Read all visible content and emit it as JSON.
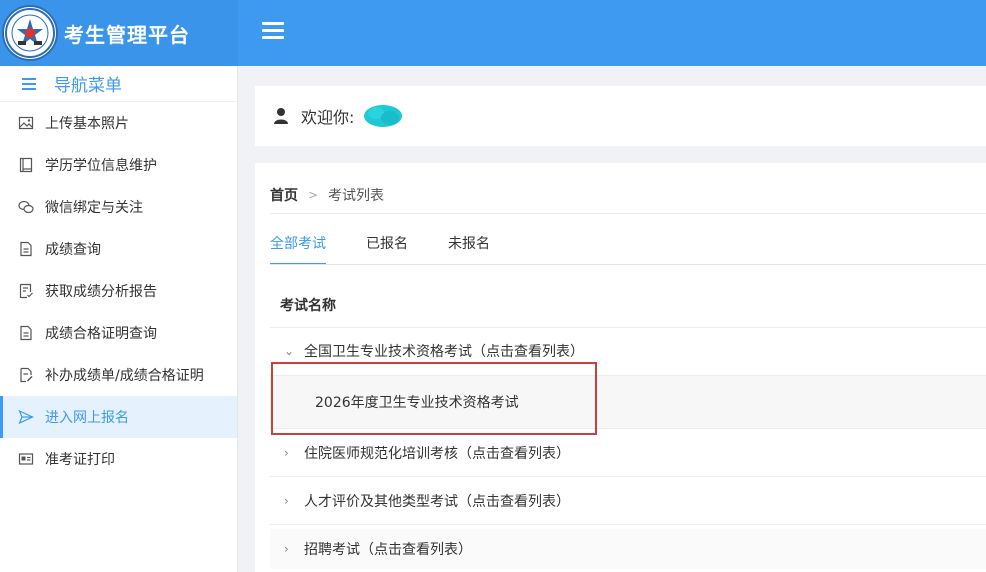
{
  "app": {
    "title": "考生管理平台"
  },
  "nav": {
    "header": "导航菜单",
    "items": [
      {
        "label": "上传基本照片",
        "icon": "image-icon"
      },
      {
        "label": "学历学位信息维护",
        "icon": "book-icon"
      },
      {
        "label": "微信绑定与关注",
        "icon": "wechat-icon"
      },
      {
        "label": "成绩查询",
        "icon": "document-icon"
      },
      {
        "label": "获取成绩分析报告",
        "icon": "report-icon"
      },
      {
        "label": "成绩合格证明查询",
        "icon": "document-icon"
      },
      {
        "label": "补办成绩单/成绩合格证明",
        "icon": "document-edit-icon"
      },
      {
        "label": "进入网上报名",
        "icon": "send-icon",
        "active": true
      },
      {
        "label": "准考证打印",
        "icon": "id-card-icon"
      }
    ]
  },
  "welcome": {
    "text": "欢迎你:"
  },
  "breadcrumb": {
    "home": "首页",
    "current": "考试列表"
  },
  "tabs": [
    {
      "label": "全部考试",
      "active": true
    },
    {
      "label": "已报名"
    },
    {
      "label": "未报名"
    }
  ],
  "table": {
    "column_header": "考试名称",
    "categories": [
      {
        "label": "全国卫生专业技术资格考试（点击查看列表）",
        "expanded": true
      },
      {
        "label": "住院医师规范化培训考核（点击查看列表）"
      },
      {
        "label": "人才评价及其他类型考试（点击查看列表）"
      },
      {
        "label": "招聘考试（点击查看列表）"
      }
    ],
    "sub_item": "2026年度卫生专业技术资格考试"
  },
  "colors": {
    "primary": "#3d9af0",
    "highlight": "#c9413f"
  }
}
